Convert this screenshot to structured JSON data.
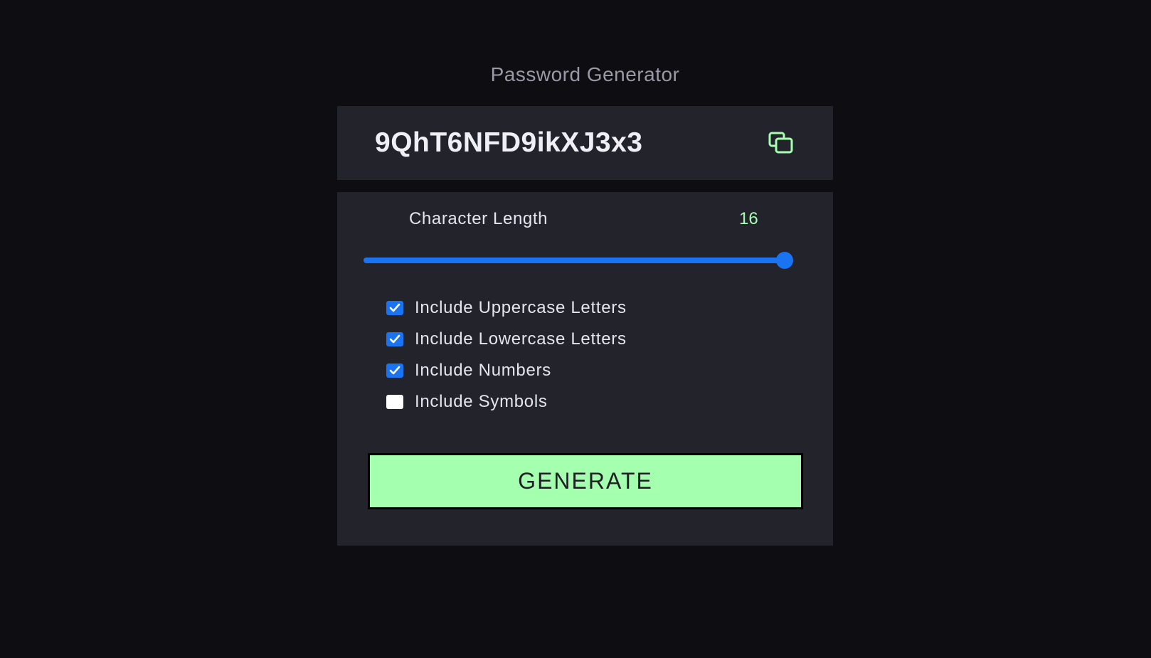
{
  "app": {
    "title": "Password Generator"
  },
  "password": {
    "value": "9QhT6NFD9ikXJ3x3",
    "copy_icon": "copy-icon"
  },
  "length": {
    "label": "Character Length",
    "value": "16",
    "slider_fraction": 1.0
  },
  "options": [
    {
      "label": "Include Uppercase Letters",
      "checked": true
    },
    {
      "label": "Include Lowercase Letters",
      "checked": true
    },
    {
      "label": "Include Numbers",
      "checked": true
    },
    {
      "label": "Include Symbols",
      "checked": false
    }
  ],
  "generate": {
    "label": "GENERATE"
  },
  "colors": {
    "background": "#0d0d12",
    "panel": "#23232c",
    "accent_green": "#a4ffaf",
    "accent_blue": "#1a73f0"
  }
}
